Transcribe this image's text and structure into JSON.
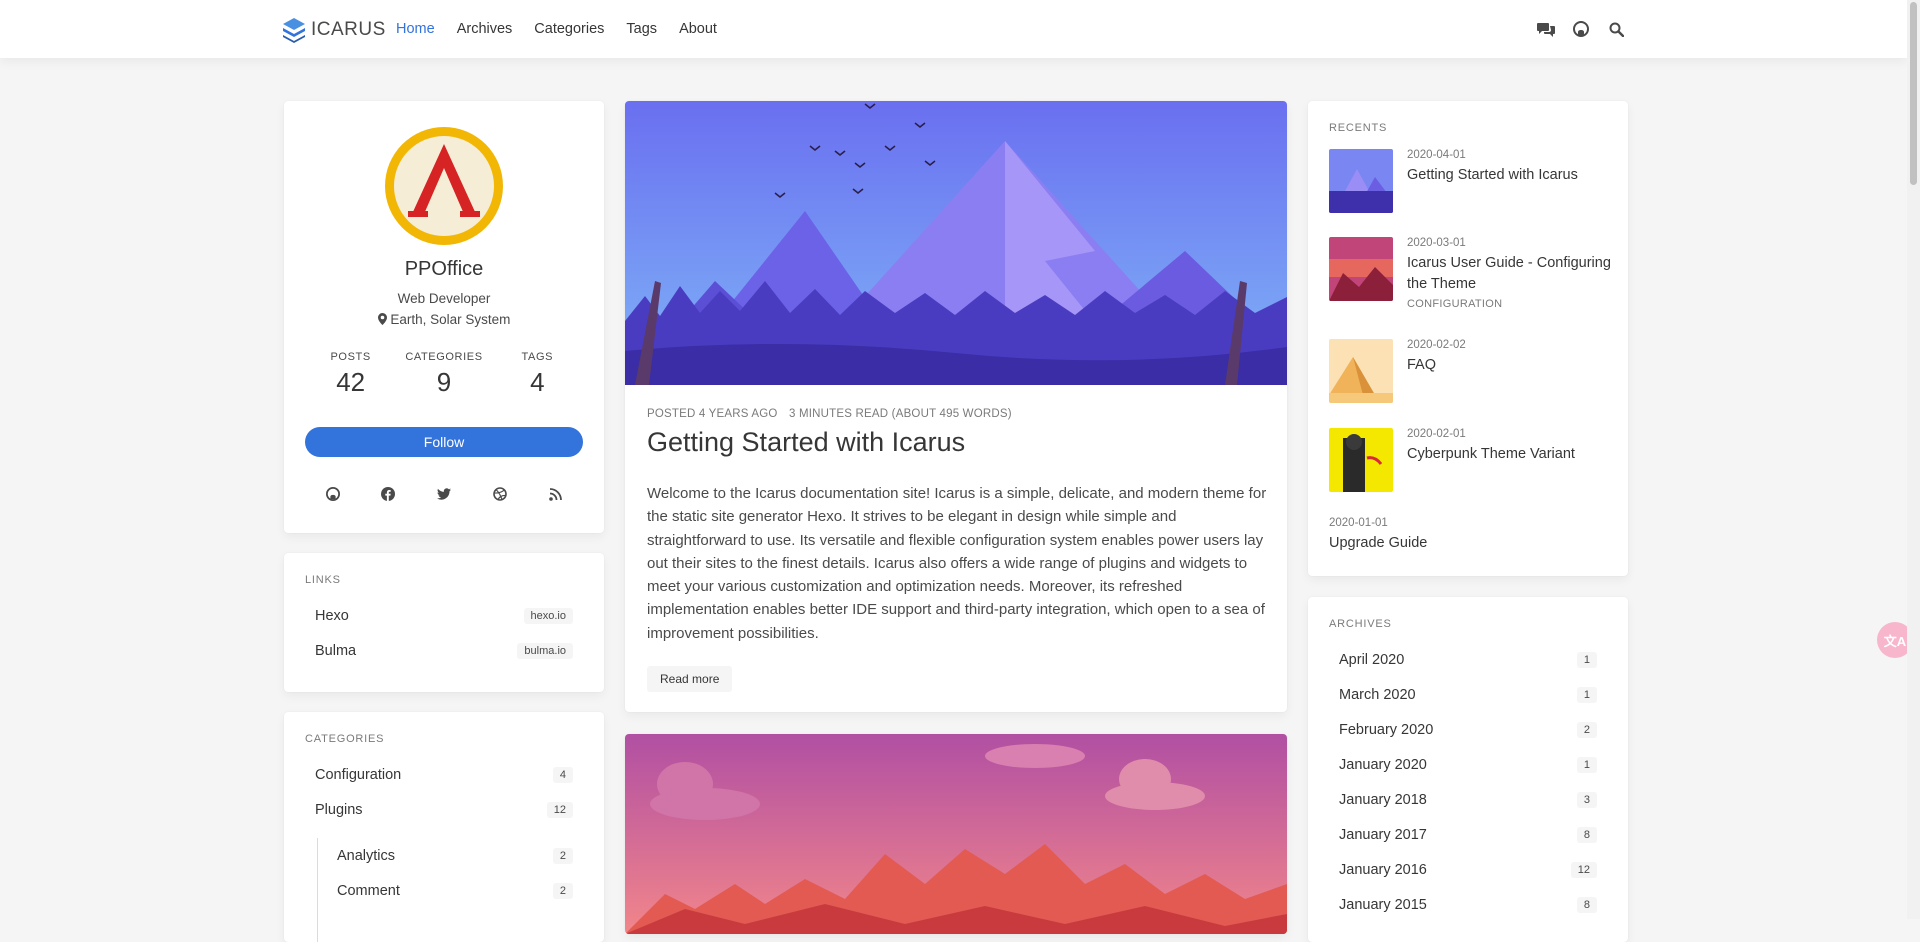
{
  "nav": {
    "brand": "ICARUS",
    "items": [
      "Home",
      "Archives",
      "Categories",
      "Tags",
      "About"
    ],
    "active": "Home",
    "icons": [
      "chat-icon",
      "github-icon",
      "search-icon"
    ]
  },
  "profile": {
    "name": "PPOffice",
    "role": "Web Developer",
    "location": "Earth, Solar System",
    "stats": [
      {
        "label": "POSTS",
        "value": "42"
      },
      {
        "label": "CATEGORIES",
        "value": "9"
      },
      {
        "label": "TAGS",
        "value": "4"
      }
    ],
    "follow": "Follow",
    "socials": [
      "github-icon",
      "facebook-icon",
      "twitter-icon",
      "dribbble-icon",
      "rss-icon"
    ]
  },
  "links": {
    "label": "LINKS",
    "items": [
      {
        "name": "Hexo",
        "tag": "hexo.io"
      },
      {
        "name": "Bulma",
        "tag": "bulma.io"
      }
    ]
  },
  "categories": {
    "label": "CATEGORIES",
    "items": [
      {
        "name": "Configuration",
        "count": "4"
      },
      {
        "name": "Plugins",
        "count": "12"
      }
    ],
    "sub": [
      {
        "name": "Analytics",
        "count": "2"
      },
      {
        "name": "Comment",
        "count": "2"
      }
    ]
  },
  "posts": [
    {
      "posted": "POSTED 4 YEARS AGO",
      "read": "3 MINUTES READ (ABOUT 495 WORDS)",
      "title": "Getting Started with Icarus",
      "body": "Welcome to the Icarus documentation site! Icarus is a simple, delicate, and modern theme for the static site generator Hexo. It strives to be elegant in design while simple and straightforward to use. Its versatile and flexible configuration system enables power users lay out their sites to the finest details. Icarus also offers a wide range of plugins and widgets to meet your various customization and optimization needs. Moreover, its refreshed implementation enables better IDE support and third-party integration, which open to a sea of improvement possibilities.",
      "read_more": "Read more"
    }
  ],
  "recents": {
    "label": "RECENTS",
    "items": [
      {
        "date": "2020-04-01",
        "title": "Getting Started with Icarus",
        "category": ""
      },
      {
        "date": "2020-03-01",
        "title": "Icarus User Guide - Configuring the Theme",
        "category": "CONFIGURATION"
      },
      {
        "date": "2020-02-02",
        "title": "FAQ",
        "category": ""
      },
      {
        "date": "2020-02-01",
        "title": "Cyberpunk Theme Variant",
        "category": ""
      },
      {
        "date": "2020-01-01",
        "title": "Upgrade Guide",
        "category": ""
      }
    ]
  },
  "archives": {
    "label": "ARCHIVES",
    "items": [
      {
        "name": "April 2020",
        "count": "1"
      },
      {
        "name": "March 2020",
        "count": "1"
      },
      {
        "name": "February 2020",
        "count": "2"
      },
      {
        "name": "January 2020",
        "count": "1"
      },
      {
        "name": "January 2018",
        "count": "3"
      },
      {
        "name": "January 2017",
        "count": "8"
      },
      {
        "name": "January 2016",
        "count": "12"
      },
      {
        "name": "January 2015",
        "count": "8"
      }
    ]
  },
  "translate": "文A",
  "colors": {
    "accent": "#3273dc",
    "background": "#f5f5f5"
  }
}
